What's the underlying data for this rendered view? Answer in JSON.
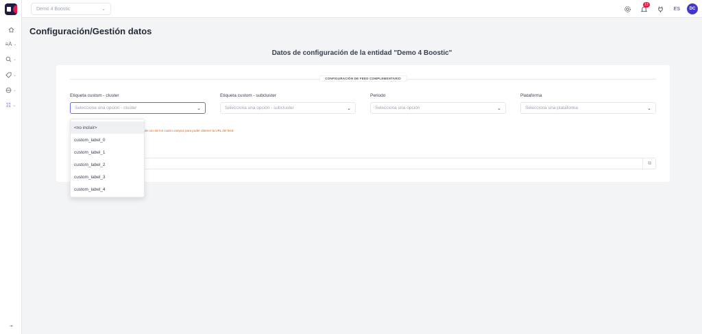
{
  "topbar": {
    "entity_select": "Demo 4 Boostic",
    "notifications_count": "13",
    "language": "ES",
    "avatar_initials": "DC"
  },
  "page": {
    "title": "Configuración/Gestión datos",
    "subtitle": "Datos de configuración de la entidad \"Demo 4 Boostic\""
  },
  "section": {
    "label": "CONFIGURACIÓN DE FEED COMPLEMENTARIO"
  },
  "fields": [
    {
      "label": "Etiqueta custom - cluster",
      "placeholder": "Selecciona una opción - cluster"
    },
    {
      "label": "Etiqueta custom - subcluster",
      "placeholder": "Selecciona una opción - subcluster"
    },
    {
      "label": "Periodo",
      "placeholder": "Selecciona una opción"
    },
    {
      "label": "Plataforma",
      "placeholder": "Selecciona una plataforma"
    }
  ],
  "note": "de uno de los cuatro campos para poder obtener la URL del feed.",
  "dropdown": {
    "options": [
      "<no incluir>",
      "custom_label_0",
      "custom_label_1",
      "custom_label_2",
      "custom_label_3",
      "custom_label_4"
    ],
    "selected_index": 0
  },
  "sidebar": {
    "items": [
      {
        "icon": "home-icon"
      },
      {
        "icon": "sort-icon"
      },
      {
        "icon": "search-icon"
      },
      {
        "icon": "tag-icon"
      },
      {
        "icon": "gauge-icon"
      },
      {
        "icon": "filters-icon",
        "active": true
      }
    ]
  },
  "colors": {
    "accent": "#6366f1",
    "warning": "#ea580c",
    "badge": "#e11d48",
    "avatar": "#4338ca"
  }
}
